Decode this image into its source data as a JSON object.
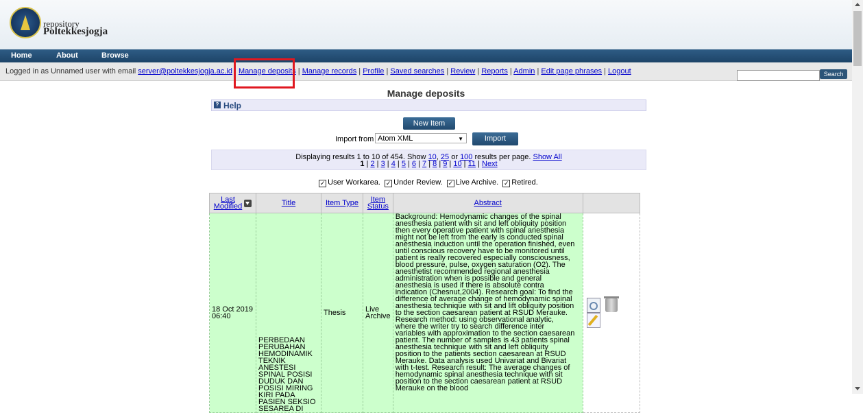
{
  "header": {
    "brand_small": "repository",
    "brand_big": "Poltekkesjogja"
  },
  "nav": {
    "items": [
      "Home",
      "About",
      "Browse"
    ]
  },
  "userbar": {
    "prefix": "Logged in as Unnamed user with email",
    "email": "server@poltekkesjogja.ac.id",
    "links": [
      "Manage deposits",
      "Manage records",
      "Profile",
      "Saved searches",
      "Review",
      "Reports",
      "Admin",
      "Edit page phrases",
      "Logout"
    ]
  },
  "search": {
    "value": "",
    "button": "Search"
  },
  "page": {
    "title": "Manage deposits",
    "help": "Help"
  },
  "actions": {
    "new_item": "New Item",
    "import_label": "Import from",
    "import_format": "Atom XML",
    "import_button": "Import"
  },
  "paging": {
    "displaying": "Displaying results 1 to 10 of 454. Show",
    "sizes": [
      "10",
      "25",
      "100"
    ],
    "sep_comma": ",",
    "sep_or": "or",
    "per_page": "results per page.",
    "show_all": "Show All",
    "current": "1",
    "pages": [
      "2",
      "3",
      "4",
      "5",
      "6",
      "7",
      "8",
      "9",
      "10",
      "11"
    ],
    "next": "Next"
  },
  "filters": [
    {
      "label": "User Workarea.",
      "checked": true
    },
    {
      "label": "Under Review.",
      "checked": true
    },
    {
      "label": "Live Archive.",
      "checked": true
    },
    {
      "label": "Retired.",
      "checked": true
    }
  ],
  "table": {
    "headers": {
      "last_modified_1": "Last",
      "last_modified_2": "Modified",
      "title": "Title",
      "item_type": "Item Type",
      "item_status_1": "Item",
      "item_status_2": "Status",
      "abstract": "Abstract"
    },
    "rows": [
      {
        "modified_date": "18 Oct 2019",
        "modified_time": "06:40",
        "title_lines": [
          "PERBEDAAN",
          "PERUBAHAN",
          "HEMODINAMIK",
          "TEKNIK",
          "ANESTESI",
          "SPINAL POSISI",
          "DUDUK DAN",
          "POSISI MIRING",
          "KIRI PADA",
          "PASIEN SEKSIO",
          "SESAREA DI"
        ],
        "item_type": "Thesis",
        "status_1": "Live",
        "status_2": "Archive",
        "abstract": "Background: Hemodynamic changes of the spinal anesthesia patient with sit and left obliquity position then every operative patient with spinal anesthesia might not be left from the early is conducted spinal anesthesia induction until the operation finished, even until conscious recovery have to be monitored until patient is really recovered especially consciousness, blood pressure, pulse, oxygen saturation (O2). The anesthetist recommended regional anesthesia administration when is possible and general anesthesia is used if there is absolute contra indication (Chesnut,2004). Research goal: To find the difference of average change of hemodynamic spinal anesthesia technique with sit and lift obliquity position to the section caesarean patient at RSUD Merauke. Research method: using observational analytic, where the writer try to search difference inter variables with approximation to the section caesarean patient. The number of samples is 43 patients spinal anesthesia technique with sit and left obliquity position to the patients section caesarean at RSUD Merauke. Data analysis used Univariat and Bivariat with t-test. Research result: The average changes of hemodynamic spinal anesthesia technique with sit position to the section caesarean patient at RSUD Merauke on the blood"
      }
    ]
  }
}
